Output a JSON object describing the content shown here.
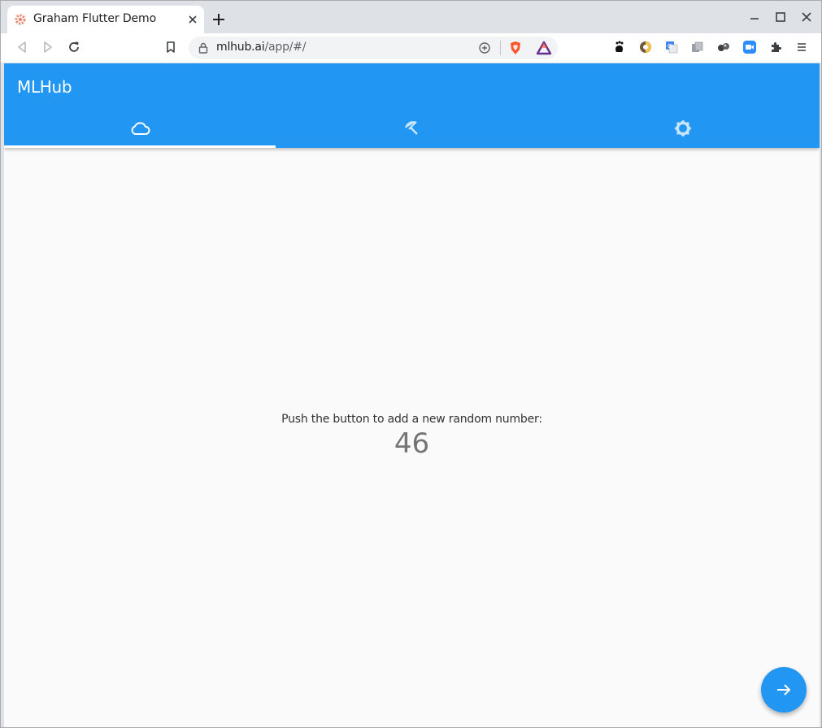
{
  "browser": {
    "tab_title": "Graham Flutter Demo",
    "url_host": "mlhub.ai",
    "url_path": "/app/#/",
    "icons": [
      "flutter-favicon-icon",
      "close-icon",
      "new-tab-icon",
      "minimize-icon",
      "maximize-icon",
      "close-window-icon",
      "back-icon",
      "forward-icon",
      "reload-icon",
      "bookmark-icon",
      "lock-icon",
      "zoom-icon",
      "brave-shields-icon",
      "brave-rewards-icon",
      "extensions-icon",
      "menu-icon"
    ]
  },
  "app": {
    "title": "MLHub",
    "tabs": [
      {
        "icon": "cloud-icon",
        "selected": true
      },
      {
        "icon": "beach-access-icon",
        "selected": false
      },
      {
        "icon": "brightness-icon",
        "selected": false
      }
    ],
    "message": "Push the button to add a new random number:",
    "counter": "46",
    "fab_icon": "arrow-forward-icon"
  },
  "colors": {
    "primary": "#2196f3",
    "background": "#fafafa",
    "counter_text": "#757575"
  }
}
